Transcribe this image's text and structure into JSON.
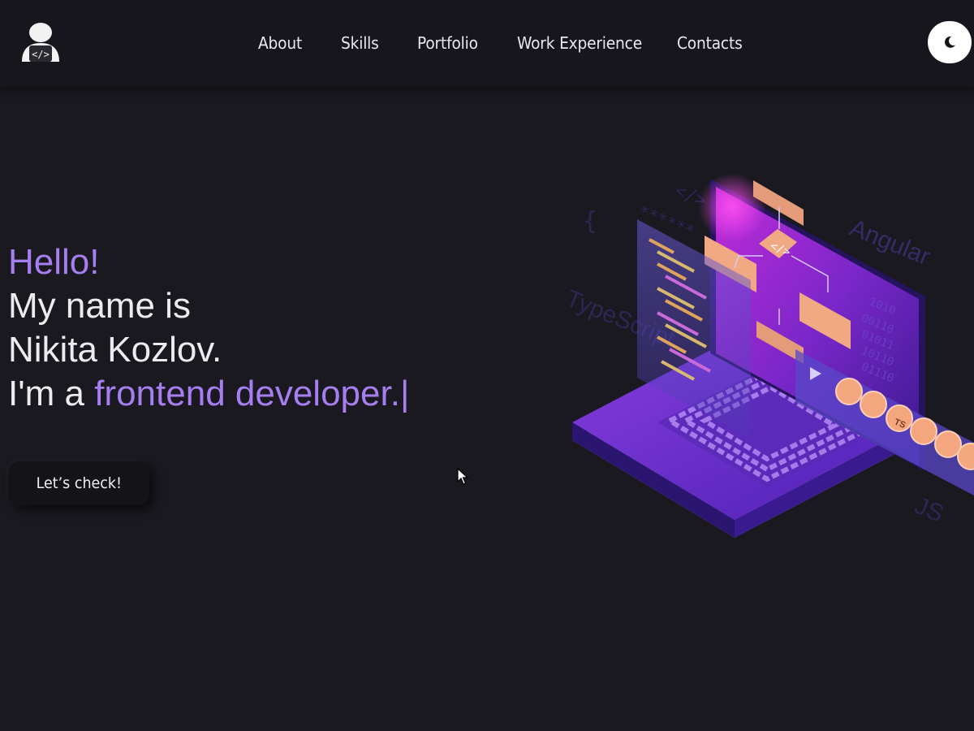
{
  "header": {
    "logo_icon": "developer-avatar-icon",
    "nav": [
      {
        "label": "About"
      },
      {
        "label": "Skills"
      },
      {
        "label": "Portfolio"
      },
      {
        "label": "Work Experience"
      },
      {
        "label": "Contacts"
      }
    ],
    "theme_toggle_icon": "moon-icon"
  },
  "hero": {
    "greeting": "Hello!",
    "line2": "My name is",
    "line3": "Nikita Kozlov.",
    "line4_prefix": "I'm a ",
    "line4_role": "frontend developer.",
    "typing_cursor": "|",
    "cta_label": "Let’s check!"
  },
  "illustration": {
    "floating_labels": {
      "angular": "Angular",
      "typescript": "TypeScript",
      "js": "JS",
      "ts_badge": "TS"
    },
    "icon": "isometric-laptop-illustration"
  },
  "colors": {
    "background": "#1a1920",
    "header": "#17161c",
    "accent": "#a57ef0",
    "text": "#ecebf0"
  }
}
